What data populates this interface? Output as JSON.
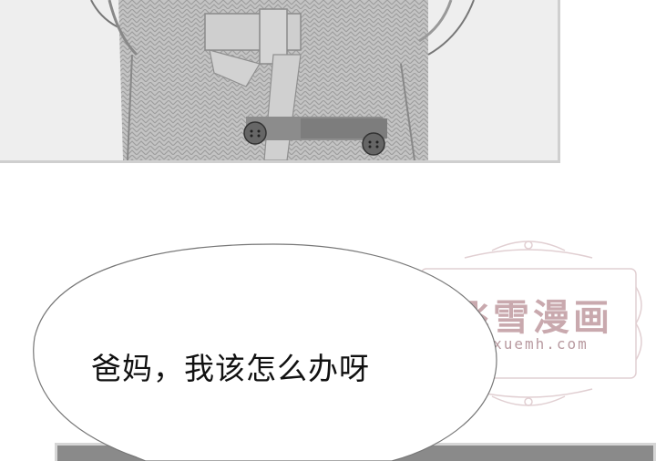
{
  "dialogue": {
    "text": "爸妈，我该怎么办呀"
  },
  "watermark": {
    "title": "飞雪漫画",
    "url": "feixuemh.com"
  },
  "colors": {
    "coat": "#bdbdbd",
    "panel_border": "#cfcfcf",
    "bubble_stroke": "#777777",
    "watermark": "#c9a9ae"
  }
}
